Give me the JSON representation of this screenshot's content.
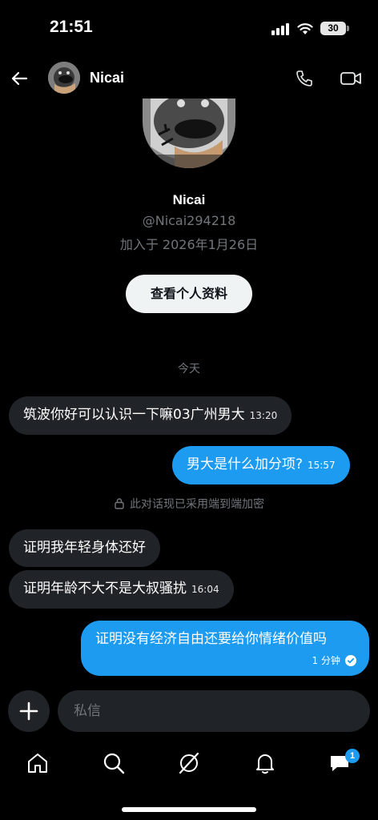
{
  "status": {
    "time": "21:51",
    "battery": "30"
  },
  "header": {
    "name": "Nicai"
  },
  "profile": {
    "name": "Nicai",
    "handle": "@Nicai294218",
    "joined": "加入于 2026年1月26日",
    "view_button": "查看个人资料"
  },
  "date_separator": "今天",
  "messages": [
    {
      "direction": "in",
      "text": "筑波你好可以认识一下嘛03广州男大",
      "time": "13:20"
    },
    {
      "direction": "out",
      "text": "男大是什么加分项?",
      "time": "15:57"
    },
    {
      "direction": "in",
      "text": "证明我年轻身体还好",
      "time": ""
    },
    {
      "direction": "in",
      "text": "证明年龄不大不是大叔骚扰",
      "time": "16:04"
    },
    {
      "direction": "out",
      "text": "证明没有经济自由还要给你情绪价值吗",
      "time": "1 分钟"
    }
  ],
  "encryption_notice": "此对话现已采用端到端加密",
  "composer": {
    "placeholder": "私信"
  },
  "tabbar": {
    "messages_badge": "1"
  },
  "colors": {
    "accent": "#1d9bf0",
    "incoming_bubble": "#202327",
    "muted": "#71767b"
  }
}
